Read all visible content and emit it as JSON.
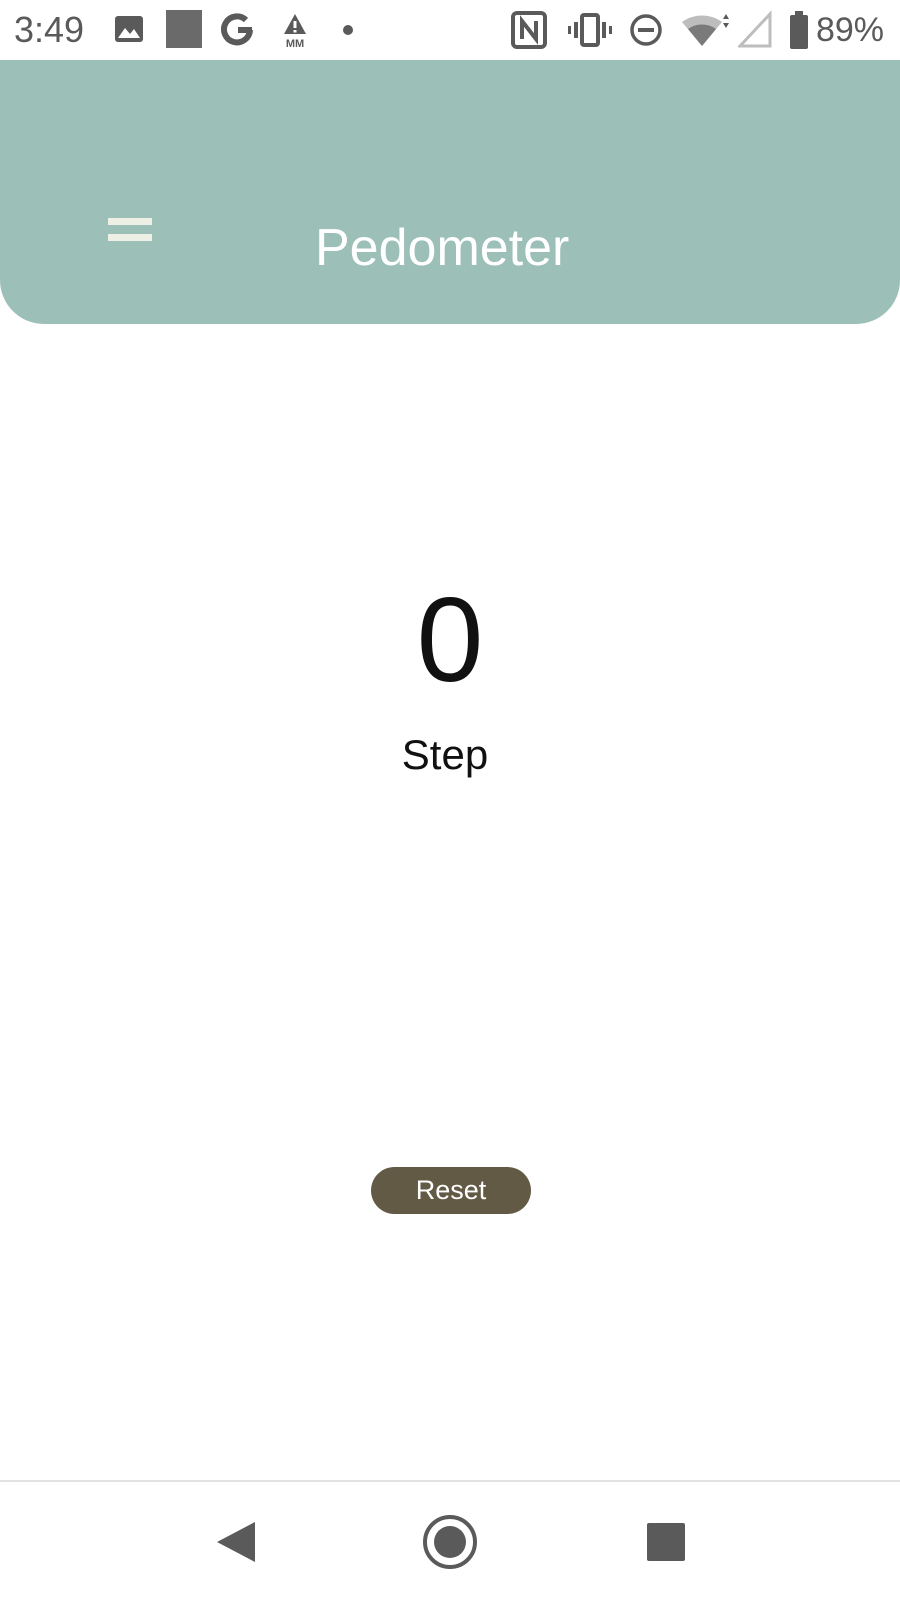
{
  "status_bar": {
    "time": "3:49",
    "battery_percent": "89%",
    "icons": [
      "image-icon",
      "square-icon",
      "google-icon",
      "mm-warning-icon",
      "dot-icon",
      "nfc-icon",
      "vibrate-icon",
      "dnd-icon",
      "wifi-icon",
      "signal-icon",
      "battery-icon"
    ]
  },
  "app_bar": {
    "title": "Pedometer",
    "menu_icon": "menu-icon",
    "background_color": "#9cbfb7"
  },
  "counter": {
    "value": "0",
    "label": "Step"
  },
  "reset_button": {
    "label": "Reset",
    "color": "#635a45"
  },
  "nav_bar": {
    "buttons": [
      "back-icon",
      "home-icon",
      "recents-icon"
    ]
  }
}
